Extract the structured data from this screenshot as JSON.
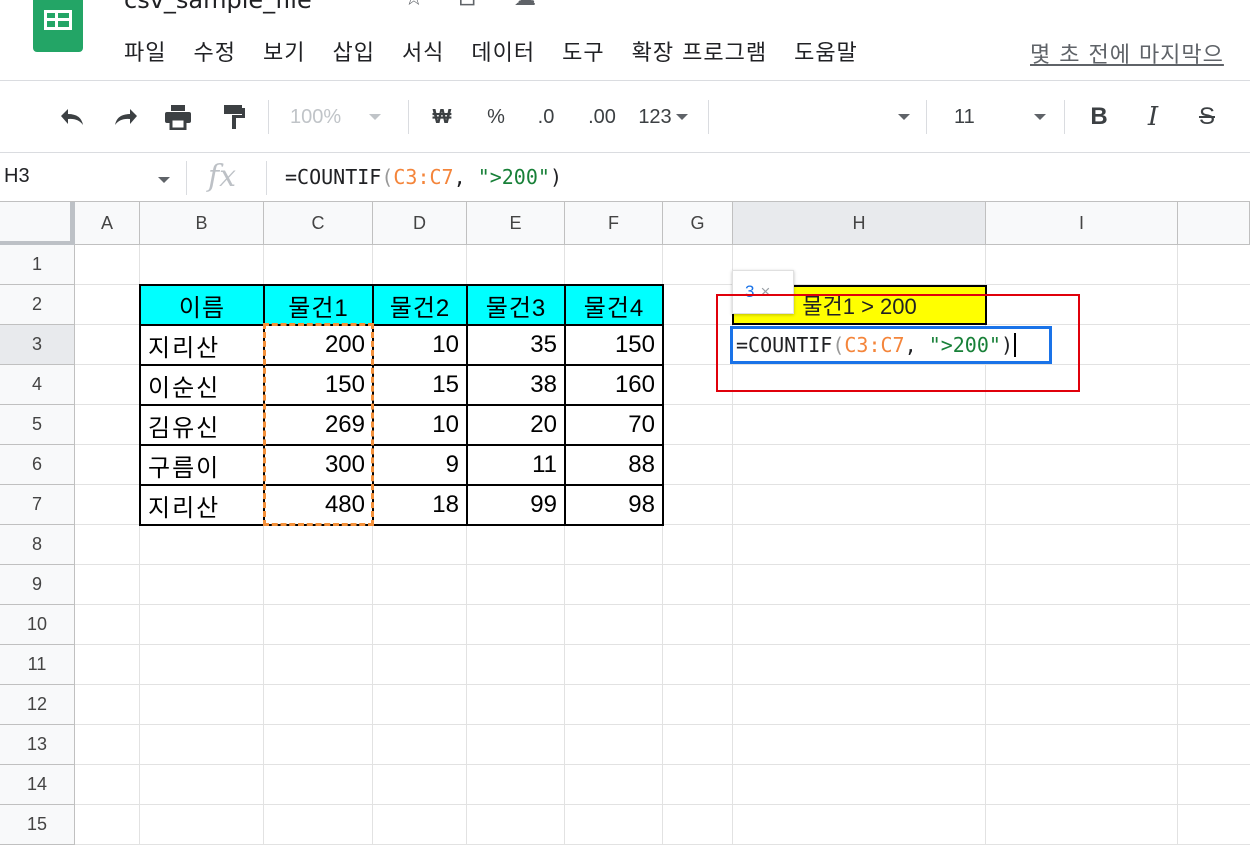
{
  "app": {
    "title": "csv_sample_file",
    "title_icons": [
      "star-icon",
      "move-to-folder-icon",
      "cloud-status-icon"
    ],
    "brand_color": "#23a566"
  },
  "menu": {
    "items": [
      "파일",
      "수정",
      "보기",
      "삽입",
      "서식",
      "데이터",
      "도구",
      "확장 프로그램",
      "도움말"
    ],
    "last_edit": "몇 초 전에 마지막으"
  },
  "toolbar": {
    "icons": [
      "undo-icon",
      "redo-icon",
      "print-icon",
      "paint-format-icon"
    ],
    "zoom": "100%",
    "currency": "₩",
    "percent": "%",
    "decrease_decimal": ".0",
    "increase_decimal": ".00",
    "more_formats": "123",
    "font": "",
    "font_size": "11",
    "bold": "B",
    "italic": "I",
    "strike": "S"
  },
  "formula_bar": {
    "name_box": "H3",
    "fx": "fx",
    "formula_prefix": "=COUNTIF",
    "formula_open": "(",
    "formula_range": "C3:C7",
    "formula_sep": ", ",
    "formula_criteria": "\">200\"",
    "formula_close": ")"
  },
  "sheet": {
    "columns": [
      "A",
      "B",
      "C",
      "D",
      "E",
      "F",
      "G",
      "H",
      "I"
    ],
    "rows": [
      "1",
      "2",
      "3",
      "4",
      "5",
      "6",
      "7",
      "8",
      "9",
      "10",
      "11",
      "12",
      "13",
      "14",
      "15"
    ],
    "active_column": "H",
    "active_row": "3",
    "table": {
      "headers": [
        "이름",
        "물건1",
        "물건2",
        "물건3",
        "물건4"
      ],
      "rows": [
        [
          "지리산",
          "200",
          "10",
          "35",
          "150"
        ],
        [
          "이순신",
          "150",
          "15",
          "38",
          "160"
        ],
        [
          "김유신",
          "269",
          "10",
          "20",
          "70"
        ],
        [
          "구름이",
          "300",
          "9",
          "11",
          "88"
        ],
        [
          "지리산",
          "480",
          "18",
          "99",
          "98"
        ]
      ]
    },
    "h2_label": "물건1 > 200",
    "h3_editing": {
      "prefix": "=COUNTIF",
      "open": "(",
      "range": "C3:C7",
      "sep": ", ",
      "criteria": "\">200\"",
      "close": ")"
    },
    "result_tooltip": {
      "value": "3",
      "close": "×"
    },
    "colors": {
      "header_fill": "#00ffff",
      "label_fill": "#ffff00",
      "range_highlight": "#f4913b",
      "edit_border": "#1a73e8",
      "annotation_box": "#e0000b"
    }
  }
}
